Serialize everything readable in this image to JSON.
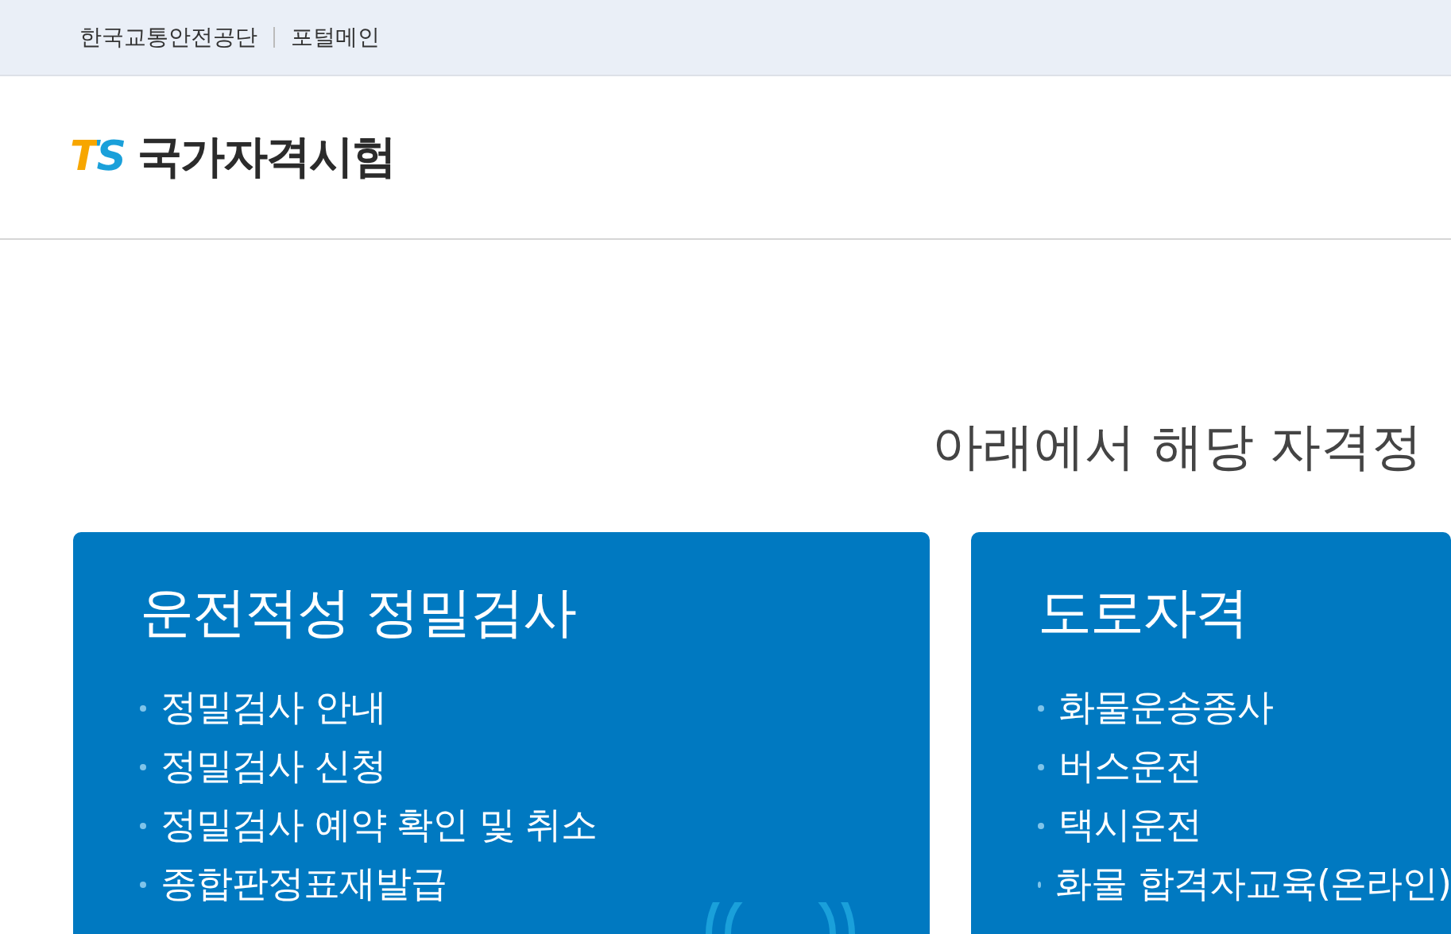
{
  "top_bar": {
    "links": [
      "한국교통안전공단",
      "포털메인"
    ]
  },
  "header": {
    "logo": {
      "mark": "TS",
      "title": "국가자격시험"
    }
  },
  "heading": "아래에서 해당 자격정",
  "cards": [
    {
      "title": "운전적성 정밀검사",
      "items": [
        "정밀검사 안내",
        "정밀검사 신청",
        "정밀검사 예약 확인 및 취소",
        "종합판정표재발급"
      ]
    },
    {
      "title": "도로자격",
      "items": [
        "화물운송종사",
        "버스운전",
        "택시운전",
        "화물 합격자교육(온라인)"
      ]
    }
  ]
}
